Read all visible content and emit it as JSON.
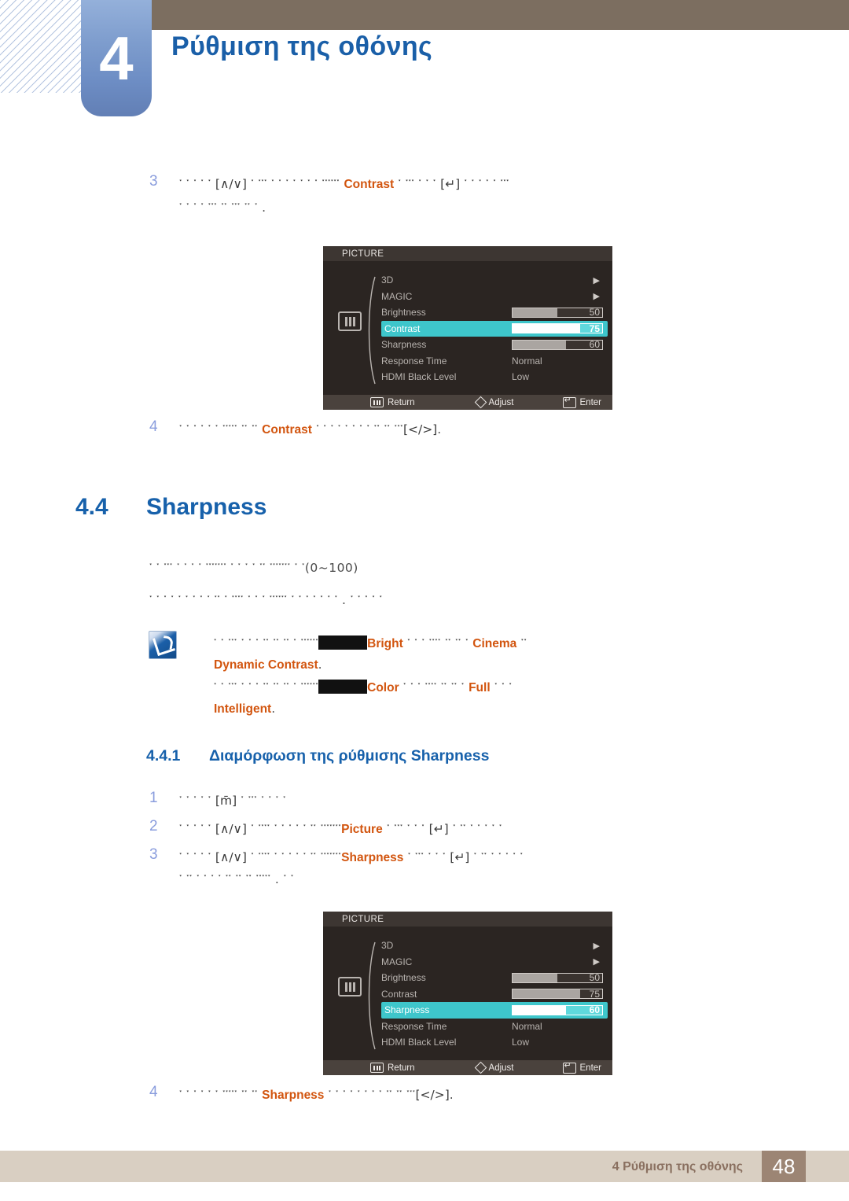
{
  "header": {
    "chapter_number": "4",
    "chapter_title": "Ρύθμιση της οθόνης"
  },
  "steps_top": [
    {
      "num": "3",
      "line1_pre": "༌ ༌ ༌ ༌ ༌ ",
      "bracket1": "[∧/∨]",
      "line1_mid": " ༌ ༌༌༌ ༌ ༌ ༌ ༌ ༌ ༌ ༌ ༌༌༌༌༌༌ ",
      "keyword": "Contrast",
      "line1_post": " ༌ ༌༌༌ ༌ ༌ ༌ ",
      "bracket2": "[↵]",
      "line1_end": " ༌ ༌ ༌ ༌ ༌ ༌༌༌",
      "line2": "༌ ༌ ༌ ༌ ༌༌༌ ༌༌ ༌༌༌ ༌༌ ༌ ."
    },
    {
      "num": "4",
      "pre": "༌ ༌ ༌ ༌ ༌ ༌ ༌༌༌༌༌ ༌༌ ༌༌ ",
      "keyword": "Contrast",
      "mid": " ༌ ༌ ༌ ༌ ༌ ༌ ༌ ༌ ༌༌ ༌༌ ༌༌༌",
      "bracket": "[</>]",
      "end": "."
    }
  ],
  "section": {
    "number": "4.4",
    "title": "Sharpness"
  },
  "intro": {
    "line1": "༌ ༌ ༌༌༌ ༌ ༌ ༌ ༌ ༌༌༌༌༌༌༌ ༌ ༌ ༌ ༌ ༌༌ ༌༌༌༌༌༌༌ ༌ ༌",
    "range": "(0~100)",
    "line2": "༌ ༌ ༌ ༌ ༌ ༌ ༌ ༌ ༌ ༌༌ ༌ ༌༌༌༌ ༌ ༌ ༌ ༌༌༌༌༌༌ ༌ ༌ ༌ ༌ ༌ ༌ ༌ . ༌ ༌ ༌ ༌ ༌"
  },
  "note": {
    "icon": "note-pen-icon",
    "para1_pre": "༌ ༌ ༌༌༌ ༌ ༌ ༌ ༌༌ ༌༌ ༌༌ ༌ ༌༌༌༌༌༌",
    "para1_kw1": "Bright",
    "para1_mid": " ༌ ༌ ༌ ༌༌༌༌ ༌༌ ༌༌ ༌ ",
    "para1_kw2": "Cinema",
    "para1_post": " ༌༌",
    "para1_kw3": "Dynamic Contrast",
    "para1_end": ".",
    "para2_pre": "༌ ༌ ༌༌༌ ༌ ༌ ༌ ༌༌ ༌༌ ༌༌ ༌ ༌༌༌༌༌༌",
    "para2_kw1": "Color",
    "para2_mid": " ༌ ༌ ༌ ༌༌༌༌ ༌༌ ༌༌ ༌ ",
    "para2_kw2": "Full",
    "para2_post": " ༌ ༌ ༌",
    "para2_kw3": "Intelligent",
    "para2_end": "."
  },
  "subsection": {
    "number": "4.4.1",
    "title": "Διαμόρφωση της ρύθμισης Sharpness"
  },
  "steps_bottom": [
    {
      "num": "1",
      "pre": "༌ ༌ ༌ ༌ ༌ ",
      "bracket": "[m̄]",
      "end": " ༌ ༌༌༌ ༌ ༌ ༌ ༌"
    },
    {
      "num": "2",
      "pre": "༌ ༌ ༌ ༌ ༌ ",
      "bracket1": "[∧/∨]",
      "mid": " ༌ ༌༌༌༌ ༌ ༌ ༌ ༌ ༌ ༌༌ ༌༌༌༌༌༌༌",
      "keyword": "Picture",
      "post": " ༌ ༌༌༌ ༌ ༌ ༌ ",
      "bracket2": "[↵]",
      "end": " ༌ ༌༌ ༌ ༌ ༌ ༌ ༌"
    },
    {
      "num": "3",
      "pre": "༌ ༌ ༌ ༌ ༌ ",
      "bracket1": "[∧/∨]",
      "mid": " ༌ ༌༌༌༌ ༌ ༌ ༌ ༌ ༌ ༌༌ ༌༌༌༌༌༌༌",
      "keyword": "Sharpness",
      "post": " ༌ ༌༌༌ ༌ ༌ ༌ ",
      "bracket2": "[↵]",
      "end": " ༌ ༌༌ ༌ ༌ ༌ ༌ ༌",
      "line2": "༌ ༌༌ ༌ ༌ ༌ ༌ ༌༌ ༌༌ ༌༌ ༌༌༌༌༌ . ༌ ༌"
    },
    {
      "num": "4",
      "pre": "༌ ༌ ༌ ༌ ༌ ༌ ༌༌༌༌༌ ༌༌ ༌༌ ",
      "keyword": "Sharpness",
      "mid": " ༌ ༌ ༌ ༌ ༌ ༌ ༌ ༌ ༌༌ ༌༌ ༌༌༌",
      "bracket": "[</>]",
      "end": "."
    }
  ],
  "osd_menu_1": {
    "title": "PICTURE",
    "category_icon": "picture-category-icon",
    "rows": [
      {
        "label": "3D",
        "type": "submenu",
        "arrow": "▶"
      },
      {
        "label": "MAGIC",
        "type": "submenu",
        "arrow": "▶"
      },
      {
        "label": "Brightness",
        "type": "slider",
        "value": "50",
        "percent": 50
      },
      {
        "label": "Contrast",
        "type": "slider",
        "value": "75",
        "percent": 75,
        "highlighted": true
      },
      {
        "label": "Sharpness",
        "type": "slider",
        "value": "60",
        "percent": 60
      },
      {
        "label": "Response Time",
        "type": "option",
        "value": "Normal"
      },
      {
        "label": "HDMI Black Level",
        "type": "option",
        "value": "Low"
      }
    ],
    "footer": [
      {
        "icon": "return-icon",
        "label": "Return"
      },
      {
        "icon": "adjust-diamond-icon",
        "label": "Adjust"
      },
      {
        "icon": "enter-icon",
        "label": "Enter"
      }
    ]
  },
  "osd_menu_2": {
    "title": "PICTURE",
    "category_icon": "picture-category-icon",
    "rows": [
      {
        "label": "3D",
        "type": "submenu",
        "arrow": "▶"
      },
      {
        "label": "MAGIC",
        "type": "submenu",
        "arrow": "▶"
      },
      {
        "label": "Brightness",
        "type": "slider",
        "value": "50",
        "percent": 50
      },
      {
        "label": "Contrast",
        "type": "slider",
        "value": "75",
        "percent": 75
      },
      {
        "label": "Sharpness",
        "type": "slider",
        "value": "60",
        "percent": 60,
        "highlighted": true
      },
      {
        "label": "Response Time",
        "type": "option",
        "value": "Normal"
      },
      {
        "label": "HDMI Black Level",
        "type": "option",
        "value": "Low"
      }
    ],
    "footer": [
      {
        "icon": "return-icon",
        "label": "Return"
      },
      {
        "icon": "adjust-diamond-icon",
        "label": "Adjust"
      },
      {
        "icon": "enter-icon",
        "label": "Enter"
      }
    ]
  },
  "footer": {
    "text": "4 Ρύθμιση της οθόνης",
    "page_number": "48"
  },
  "colors": {
    "header_bar": "#7c6e60",
    "chapter_badge": "#7d9ccd",
    "heading_blue": "#1761ab",
    "keyword_orange": "#d2550f",
    "osd_highlight": "#3ec6cb",
    "footer_bar": "#d9cfc2",
    "page_box": "#9c8574"
  }
}
